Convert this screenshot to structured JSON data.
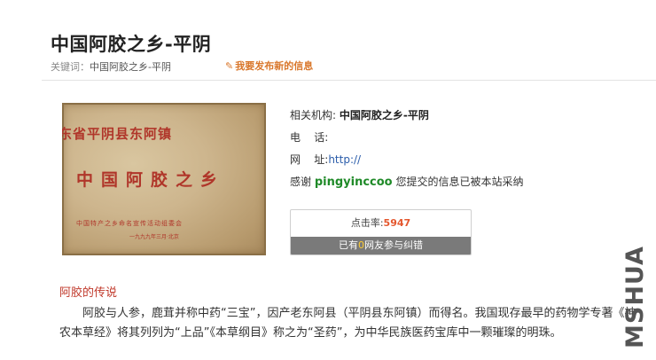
{
  "header": {
    "title": "中国阿胶之乡-平阴",
    "keywords_label": "关键词：",
    "keywords_value": "中国阿胶之乡-平阴",
    "publish_icon": "pencil-icon",
    "publish_label": "我要发布新的信息"
  },
  "plaque": {
    "top_text": "东省平阴县东阿镇",
    "main_text": "中国阿胶之乡",
    "sub_text": "中国特产之乡命名宣传活动组委会",
    "date_text": "一九九九年三月·北京"
  },
  "info": {
    "org_label": "相关机构: ",
    "org_value": "中国阿胶之乡-平阴",
    "phone_label": "电    话:",
    "web_label": "网    址:",
    "web_value": "http://",
    "thanks_prefix": "感谢 ",
    "username": "pingyinccoo",
    "thanks_suffix": " 您提交的信息已被本站采纳"
  },
  "stats": {
    "click_label": "点击率:",
    "click_value": "5947",
    "correction_prefix": "已有",
    "correction_count": "0",
    "correction_suffix": "网友参与纠错"
  },
  "article": {
    "heading": "阿胶的传说",
    "body": "阿胶与人参，鹿茸并称中药“三宝”，因产老东阿县（平阴县东阿镇）而得名。我国现存最早的药物学专著《神农本草经》将其列列为“上品”《本草纲目》称之为“圣药”，为中华民族医药宝库中一颗璀璨的明珠。"
  },
  "watermark": "MSHUA"
}
